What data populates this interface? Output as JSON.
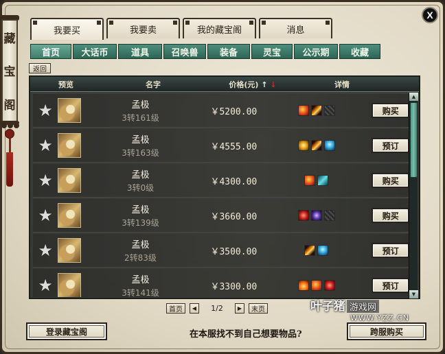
{
  "banner": {
    "chars": [
      "藏",
      "宝",
      "阁"
    ]
  },
  "close_label": "X",
  "main_tabs": [
    {
      "label": "我要买"
    },
    {
      "label": "我要卖"
    },
    {
      "label": "我的藏宝阁"
    },
    {
      "label": "消息"
    }
  ],
  "sub_tabs": [
    {
      "label": "首页"
    },
    {
      "label": "大话币"
    },
    {
      "label": "道具"
    },
    {
      "label": "召唤兽"
    },
    {
      "label": "装备"
    },
    {
      "label": "灵宝"
    },
    {
      "label": "公示期"
    },
    {
      "label": "收藏"
    }
  ],
  "back_label": "返回",
  "table": {
    "headers": {
      "preview": "预览",
      "name": "名字",
      "price": "价格(元)",
      "sort_up": "↑",
      "sort_down": "↓",
      "detail": "详情"
    },
    "rows": [
      {
        "name": "孟极",
        "level": "3转161级",
        "price": "￥5200.00",
        "action": "购买",
        "skills": [
          "fire",
          "claw",
          "dark"
        ]
      },
      {
        "name": "孟极",
        "level": "3转163级",
        "price": "￥4555.00",
        "action": "预订",
        "skills": [
          "gold",
          "claw",
          "blue"
        ]
      },
      {
        "name": "孟极",
        "level": "3转0级",
        "price": "￥4300.00",
        "action": "购买",
        "skills": [
          "fire",
          "cyan"
        ]
      },
      {
        "name": "孟极",
        "level": "3转139级",
        "price": "￥3660.00",
        "action": "购买",
        "skills": [
          "red",
          "purple",
          "dark"
        ]
      },
      {
        "name": "孟极",
        "level": "2转83级",
        "price": "￥3500.00",
        "action": "预订",
        "skills": [
          "claw",
          "blue"
        ]
      },
      {
        "name": "孟极",
        "level": "3转141级",
        "price": "￥3300.00",
        "action": "预订",
        "skills": [
          "orange",
          "fire",
          "red"
        ]
      }
    ]
  },
  "pager": {
    "first": "首页",
    "prev": "◀",
    "current": "1/2",
    "next": "▶",
    "last": "末页"
  },
  "footer": {
    "login": "登录藏宝阁",
    "not_found": "在本服找不到自己想要物品?",
    "cross_server": "跨服购买"
  },
  "watermark": {
    "main": "叶子猪",
    "tag": "游戏网",
    "url": "WWW.YZZ.CN"
  },
  "icons": {
    "star": "star-icon",
    "avatar": "pet-avatar-icon"
  }
}
